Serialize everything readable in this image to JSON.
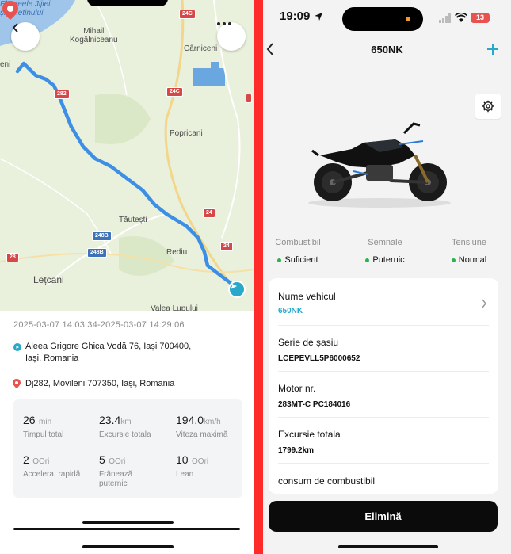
{
  "trip": {
    "map_labels": {
      "lake": "Elesteele Jijiei\nși Miletinului",
      "mihail": "Mihail\nKogălniceanu",
      "carniceni": "Cârniceni",
      "popricani": "Popricani",
      "tautesti": "Tăutești",
      "rediu": "Rediu",
      "letcani": "Lețcani",
      "valea": "Valea Lupului",
      "eni": "eni"
    },
    "road_badges": {
      "r24c_top": "24C",
      "r24c_mid": "24C",
      "r282": "282",
      "r24_a": "24",
      "r24_b": "24",
      "r248b_a": "248B",
      "r248b_b": "248B",
      "r28": "28"
    },
    "timestamp": "2025-03-07 14:03:34-2025-03-07 14:29:06",
    "start_address": "Aleea Grigore Ghica Vodă 76, Iași 700400,\nIași, Romania",
    "end_address": "Dj282, Movileni 707350, Iași, Romania",
    "stats": [
      {
        "value": "26",
        "unit": "min",
        "label": "Timpul total"
      },
      {
        "value": "23.4",
        "unit": "km",
        "label": "Excursie totala"
      },
      {
        "value": "194.0",
        "unit": "km/h",
        "label": "Viteza maximă"
      },
      {
        "value": "2",
        "unit": "OOri",
        "label": "Accelera. rapidă"
      },
      {
        "value": "5",
        "unit": "OOri",
        "label": "Frânează puternic"
      },
      {
        "value": "10",
        "unit": "OOri",
        "label": "Lean"
      }
    ],
    "colors": {
      "route": "#3d8fe6",
      "accent": "#29a9c9",
      "pin": "#e8524f"
    }
  },
  "vehicle": {
    "status_time": "19:09",
    "battery": "13",
    "title": "650NK",
    "signals": [
      {
        "header": "Combustibil",
        "value": "Suficient"
      },
      {
        "header": "Semnale",
        "value": "Puternic"
      },
      {
        "header": "Tensiune",
        "value": "Normal"
      }
    ],
    "rows": [
      {
        "key": "Nume vehicul",
        "value": "650NK"
      },
      {
        "key": "Serie de șasiu",
        "value": "LCEPEVLL5P6000652"
      },
      {
        "key": "Motor nr.",
        "value": "283MT-C PC184016"
      },
      {
        "key": "Excursie totala",
        "value": "1799.2km"
      },
      {
        "key": "consum de combustibil",
        "value": ""
      }
    ],
    "delete_label": "Elimină",
    "colors": {
      "accent": "#29a9c9",
      "ok": "#2ab34a"
    }
  }
}
